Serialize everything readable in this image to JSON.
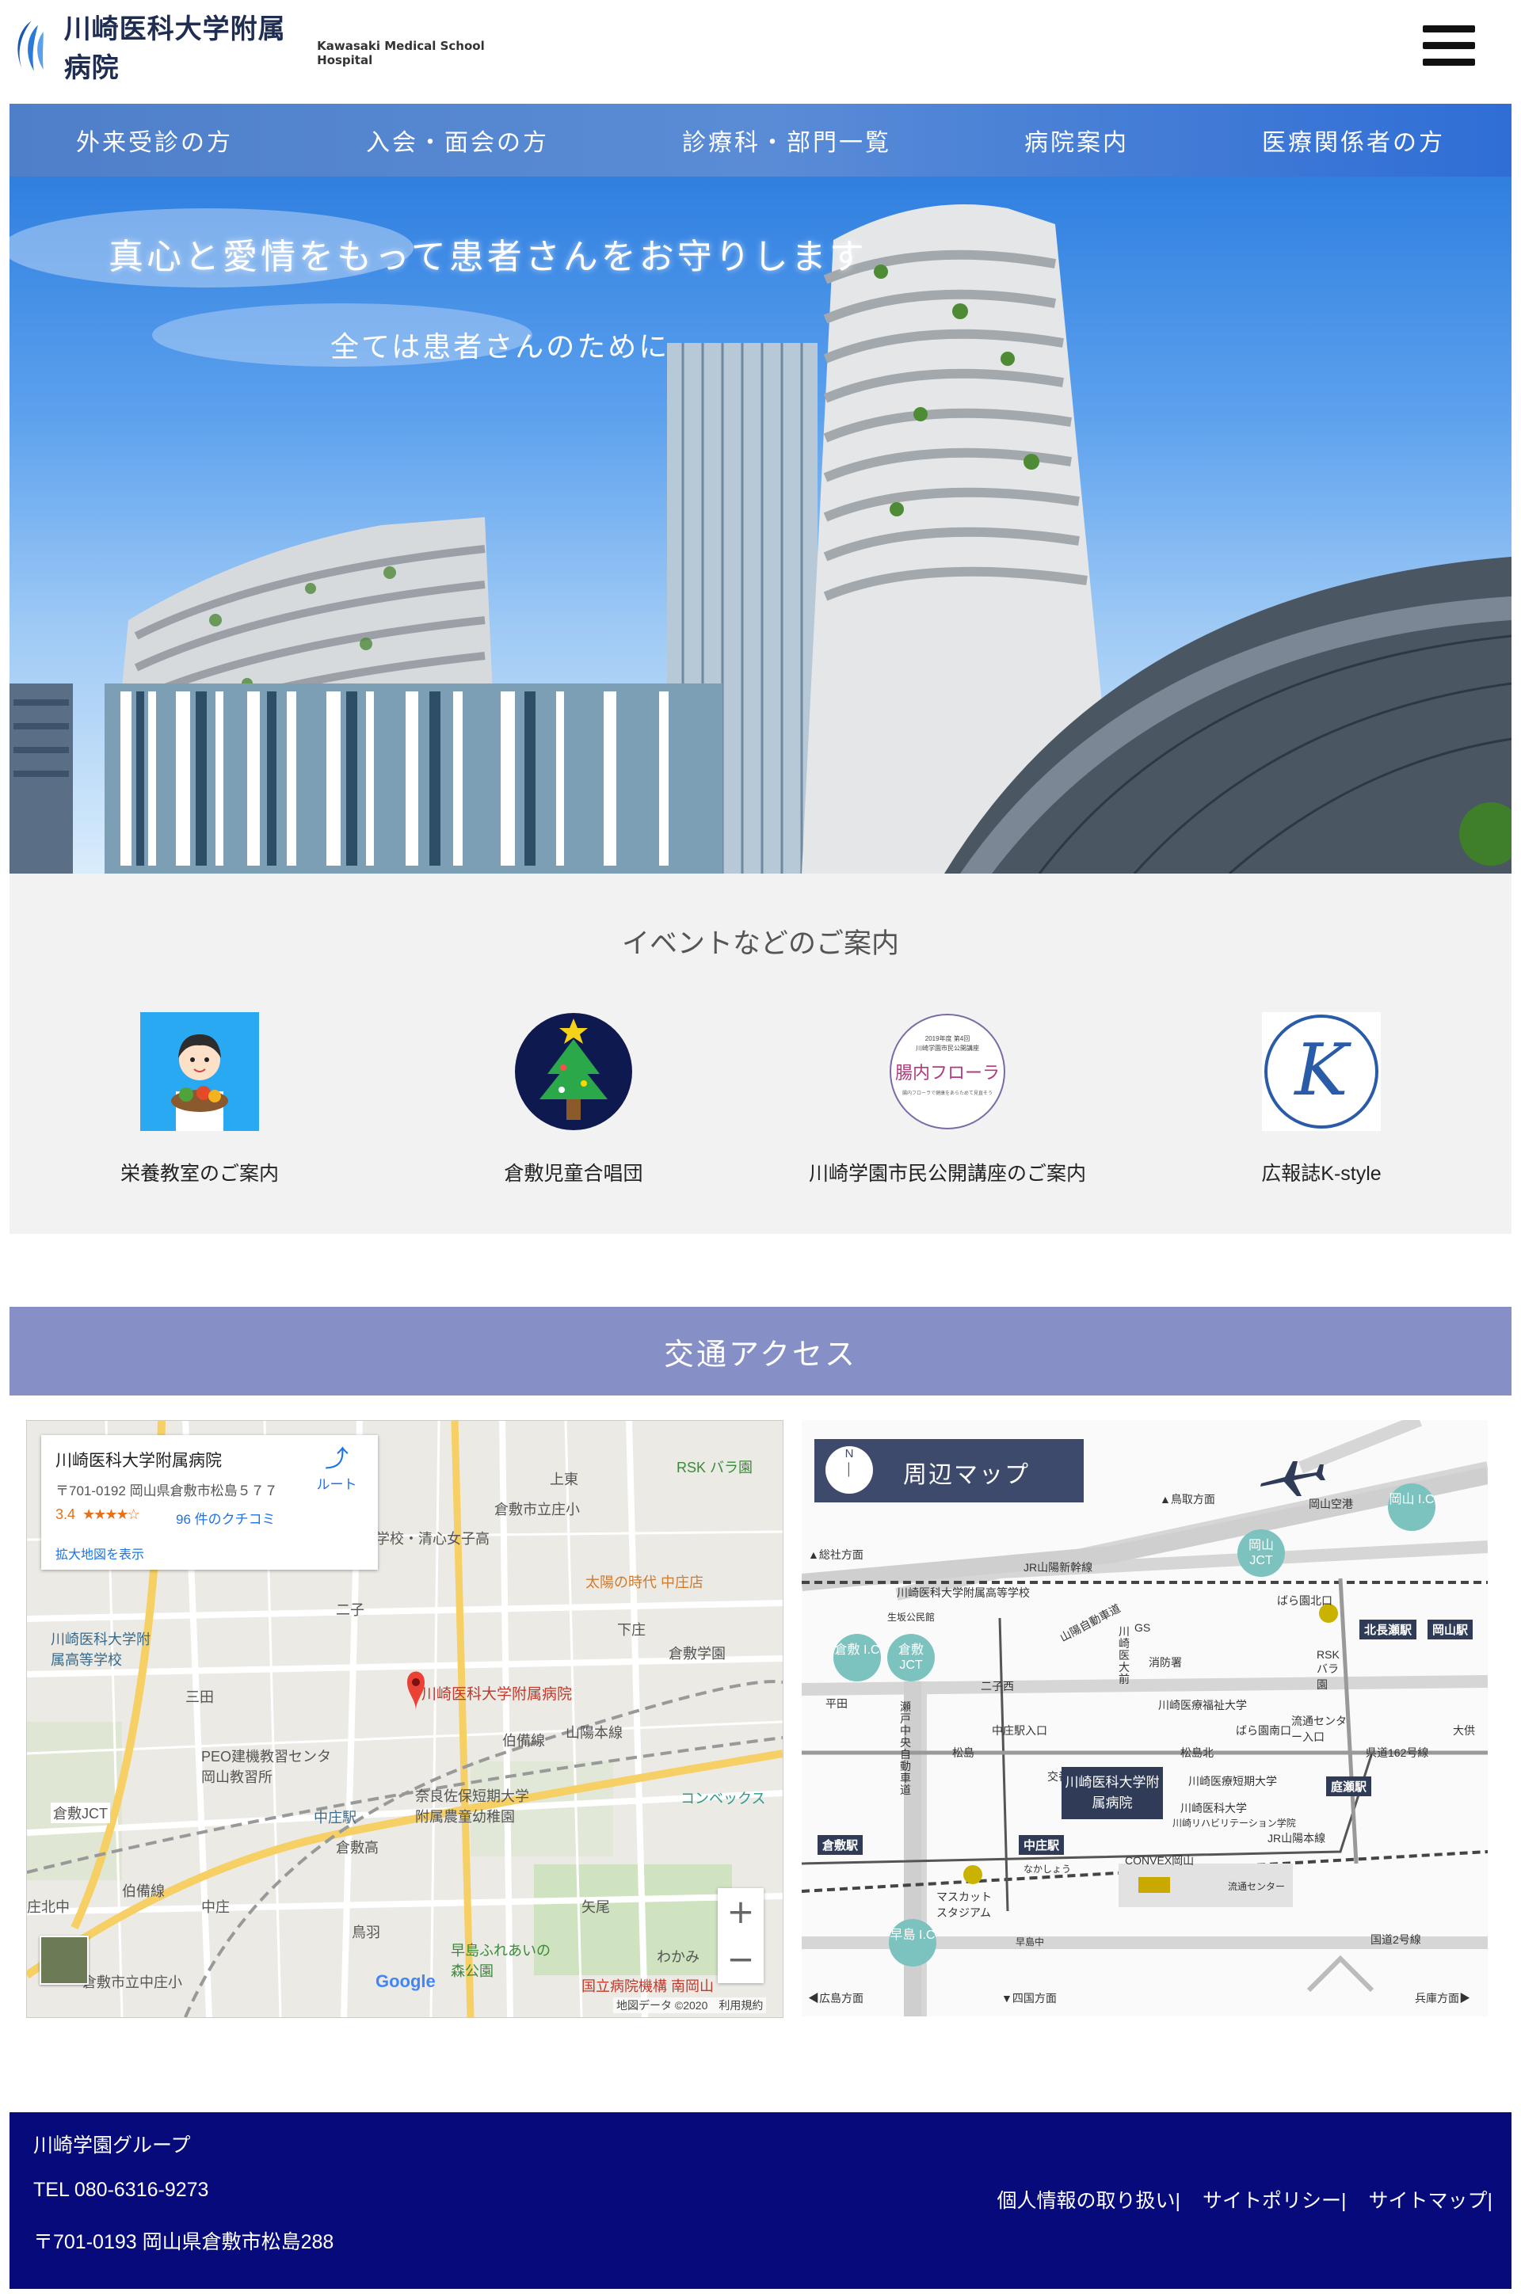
{
  "header": {
    "logo_ja": "川崎医科大学附属病院",
    "logo_en": "Kawasaki Medical School Hospital",
    "menu_icon": "hamburger-menu-icon"
  },
  "nav": {
    "items": [
      "外来受診の方",
      "入会・面会の方",
      "診療科・部門一覧",
      "病院案内",
      "医療関係者の方"
    ]
  },
  "hero": {
    "title": "真心と愛情をもって患者さんをお守りします",
    "subtitle": "全ては患者さんのために"
  },
  "events": {
    "heading": "イベントなどのご案内",
    "items": [
      {
        "label": "栄養教室のご案内",
        "icon": "nutritionist-illustration"
      },
      {
        "label": "倉敷児童合唱団",
        "icon": "christmas-tree-icon"
      },
      {
        "label": "川崎学園市民公開講座のご案内",
        "icon": "lecture-badge",
        "badge_top": "2019年度 第4回",
        "badge_mid": "川崎学園市民公開講座",
        "badge_main": "腸内フローラ",
        "badge_bottom": "腸内フローラで健康をあらためて見直そう"
      },
      {
        "label": "広報誌K-style",
        "icon": "k-style-logo",
        "letter": "K"
      }
    ]
  },
  "access": {
    "heading": "交通アクセス",
    "google_map": {
      "place_name": "川崎医科大学附属病院",
      "address": "〒701-0192 岡山県倉敷市松島５７７",
      "rating": "3.4",
      "stars": "★★★★☆",
      "reviews": "96 件のクチコミ",
      "enlarge": "拡大地図を表示",
      "route": "ルート",
      "pin_label": "川崎医科大学附属病院",
      "zoom_in": "+",
      "zoom_out": "−",
      "logo": "Google",
      "credit": "地図データ ©2020　利用規約",
      "labels": [
        "RSK バラ園",
        "上東",
        "倉敷市立庄小",
        "学校・清心女子高",
        "太陽の時代 中庄店",
        "二子",
        "下庄",
        "倉敷学園",
        "川崎医科大学附属高等学校",
        "三田",
        "伯備線",
        "山陽本線",
        "PEO建機教習センタ 岡山教習所",
        "奈良佐保短期大学附属農童幼稚園",
        "中庄駅",
        "倉敷高",
        "コンベックス",
        "倉敷JCT",
        "伯備線",
        "中庄",
        "矢尾",
        "鳥羽",
        "早島ふれあいの森公園",
        "わかみ",
        "国立病院機構 南岡山",
        "倉敷市立中庄小",
        "庄北中"
      ]
    },
    "area_map": {
      "title": "周辺マップ",
      "compass": "N",
      "hospital": "川崎医科大学附属病院",
      "labels": [
        "▲鳥取方面",
        "岡山空港",
        "▲総社方面",
        "JR山陽新幹線",
        "川崎医科大学附属高等学校",
        "生坂公民館",
        "山陽自動車道",
        "ばら園北口",
        "北長瀬駅",
        "岡山駅",
        "GS",
        "消防署",
        "川崎医大前",
        "川崎医療福祉大学",
        "RSKバラ園",
        "平田",
        "二子西",
        "瀬戸中央自動車道",
        "中庄駅入口",
        "松島北",
        "ばら園南口",
        "流通センター入口",
        "県道162号線",
        "大供",
        "松島",
        "交番",
        "川崎医療短期大学",
        "川崎医科大学",
        "川崎リハビリテーション学院",
        "庭瀬駅",
        "JR山陽本線",
        "倉敷駅",
        "中庄駅",
        "なかしょう",
        "マスカットスタジアム",
        "CONVEX岡山",
        "流通センター",
        "早島中",
        "国道2号線",
        "◀広島方面",
        "▼四国方面",
        "兵庫方面▶"
      ],
      "interchanges": [
        "岡山 I.C",
        "岡山 JCT",
        "倉敷 I.C",
        "倉敷 JCT",
        "早島 I.C"
      ]
    }
  },
  "footer": {
    "group": "川崎学園グループ",
    "tel": "TEL 080-6316-9273",
    "address": "〒701-0193 岡山県倉敷市松島288",
    "links": [
      "個人情報の取り扱い|",
      "サイトポリシー|",
      "サイトマップ|"
    ]
  },
  "colors": {
    "nav_start": "#4f7fc9",
    "nav_end": "#2f6ed6",
    "access_bar": "#8690c7",
    "footer": "#060a7a",
    "map_accent": "#7cc2be"
  }
}
